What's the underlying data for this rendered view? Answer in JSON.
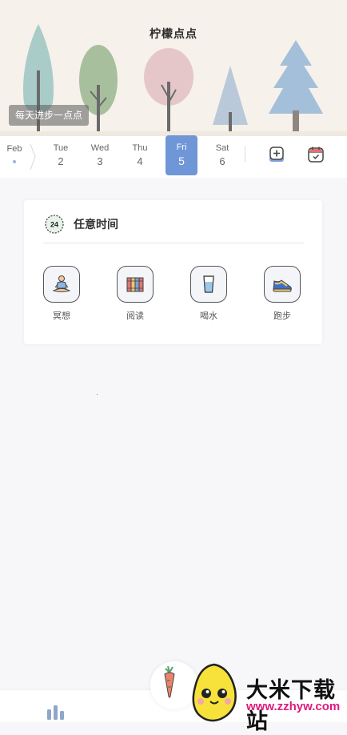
{
  "header": {
    "app_title": "柠檬点点",
    "slogan": "每天进步一点点"
  },
  "date_strip": {
    "month": "Feb",
    "days": [
      {
        "name": "Tue",
        "date": "2",
        "active": false
      },
      {
        "name": "Wed",
        "date": "3",
        "active": false
      },
      {
        "name": "Thu",
        "date": "4",
        "active": false
      },
      {
        "name": "Fri",
        "date": "5",
        "active": true
      },
      {
        "name": "Sat",
        "date": "6",
        "active": false
      }
    ],
    "add_icon": "add-habit-icon",
    "calendar_icon": "calendar-icon"
  },
  "card": {
    "badge_text": "24",
    "title": "任意时间",
    "habits": [
      {
        "label": "冥想",
        "icon": "meditation-icon"
      },
      {
        "label": "阅读",
        "icon": "books-icon"
      },
      {
        "label": "喝水",
        "icon": "water-glass-icon"
      },
      {
        "label": "跑步",
        "icon": "running-shoe-icon"
      }
    ]
  },
  "bottom_nav": {
    "stats_icon": "stats-bars-icon",
    "center_icon": "carrot-icon"
  },
  "watermark": {
    "name": "大米下载站",
    "url": "www.zzhyw.com"
  },
  "colors": {
    "accent": "#6f96d6",
    "header_bg": "#f6f1ea",
    "page_bg": "#f7f7fa",
    "watermark_url": "#e0197d"
  }
}
